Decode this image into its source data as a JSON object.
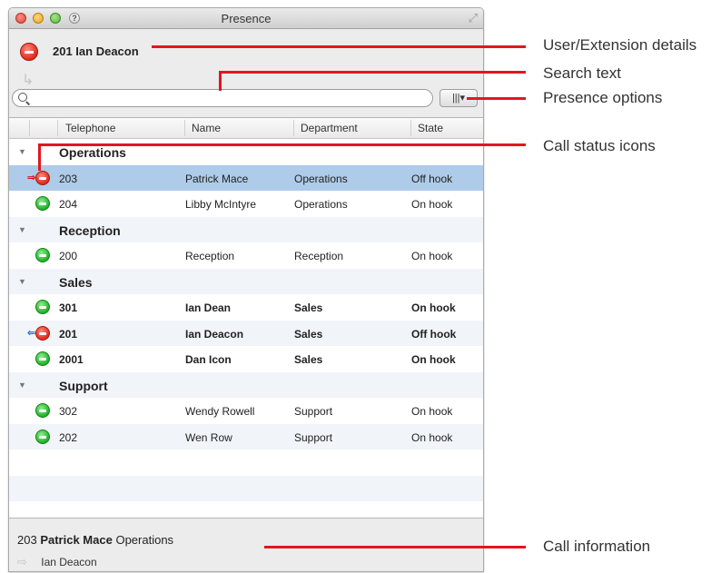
{
  "window": {
    "title": "Presence"
  },
  "user": {
    "extension": "201",
    "name": "Ian Deacon",
    "display": "201 Ian Deacon",
    "status": "busy"
  },
  "search": {
    "placeholder": "",
    "value": ""
  },
  "presence_options": {
    "label": "|||▾"
  },
  "columns": {
    "telephone": "Telephone",
    "name": "Name",
    "department": "Department",
    "state": "State"
  },
  "groups": [
    {
      "name": "Operations",
      "rows": [
        {
          "tel": "203",
          "name": "Patrick Mace",
          "dept": "Operations",
          "state": "Off hook",
          "status": "busy",
          "direction": "outgoing",
          "selected": true,
          "bold": false
        },
        {
          "tel": "204",
          "name": "Libby McIntyre",
          "dept": "Operations",
          "state": "On hook",
          "status": "available",
          "selected": false,
          "bold": false
        }
      ]
    },
    {
      "name": "Reception",
      "rows": [
        {
          "tel": "200",
          "name": "Reception",
          "dept": "Reception",
          "state": "On hook",
          "status": "available",
          "selected": false,
          "bold": false
        }
      ]
    },
    {
      "name": "Sales",
      "rows": [
        {
          "tel": "301",
          "name": "Ian Dean",
          "dept": "Sales",
          "state": "On hook",
          "status": "available",
          "selected": false,
          "bold": true
        },
        {
          "tel": "201",
          "name": "Ian Deacon",
          "dept": "Sales",
          "state": "Off hook",
          "status": "busy",
          "direction": "incoming",
          "selected": false,
          "bold": true
        },
        {
          "tel": "2001",
          "name": "Dan Icon",
          "dept": "Sales",
          "state": "On hook",
          "status": "available",
          "selected": false,
          "bold": true
        }
      ]
    },
    {
      "name": "Support",
      "rows": [
        {
          "tel": "302",
          "name": "Wendy Rowell",
          "dept": "Support",
          "state": "On hook",
          "status": "available",
          "selected": false,
          "bold": false
        },
        {
          "tel": "202",
          "name": "Wen Row",
          "dept": "Support",
          "state": "On hook",
          "status": "available",
          "selected": false,
          "bold": false
        }
      ]
    }
  ],
  "call_info": {
    "extension": "203",
    "name": "Patrick Mace",
    "department": "Operations",
    "party": "Ian Deacon"
  },
  "callouts": {
    "user_details": "User/Extension details",
    "search_text": "Search text",
    "presence_options": "Presence options",
    "call_status_icons": "Call status icons",
    "call_information": "Call information"
  },
  "colors": {
    "callout": "#e3161e",
    "selected_row": "#aecbe9",
    "busy": "#e0291b",
    "available": "#22b02b"
  }
}
